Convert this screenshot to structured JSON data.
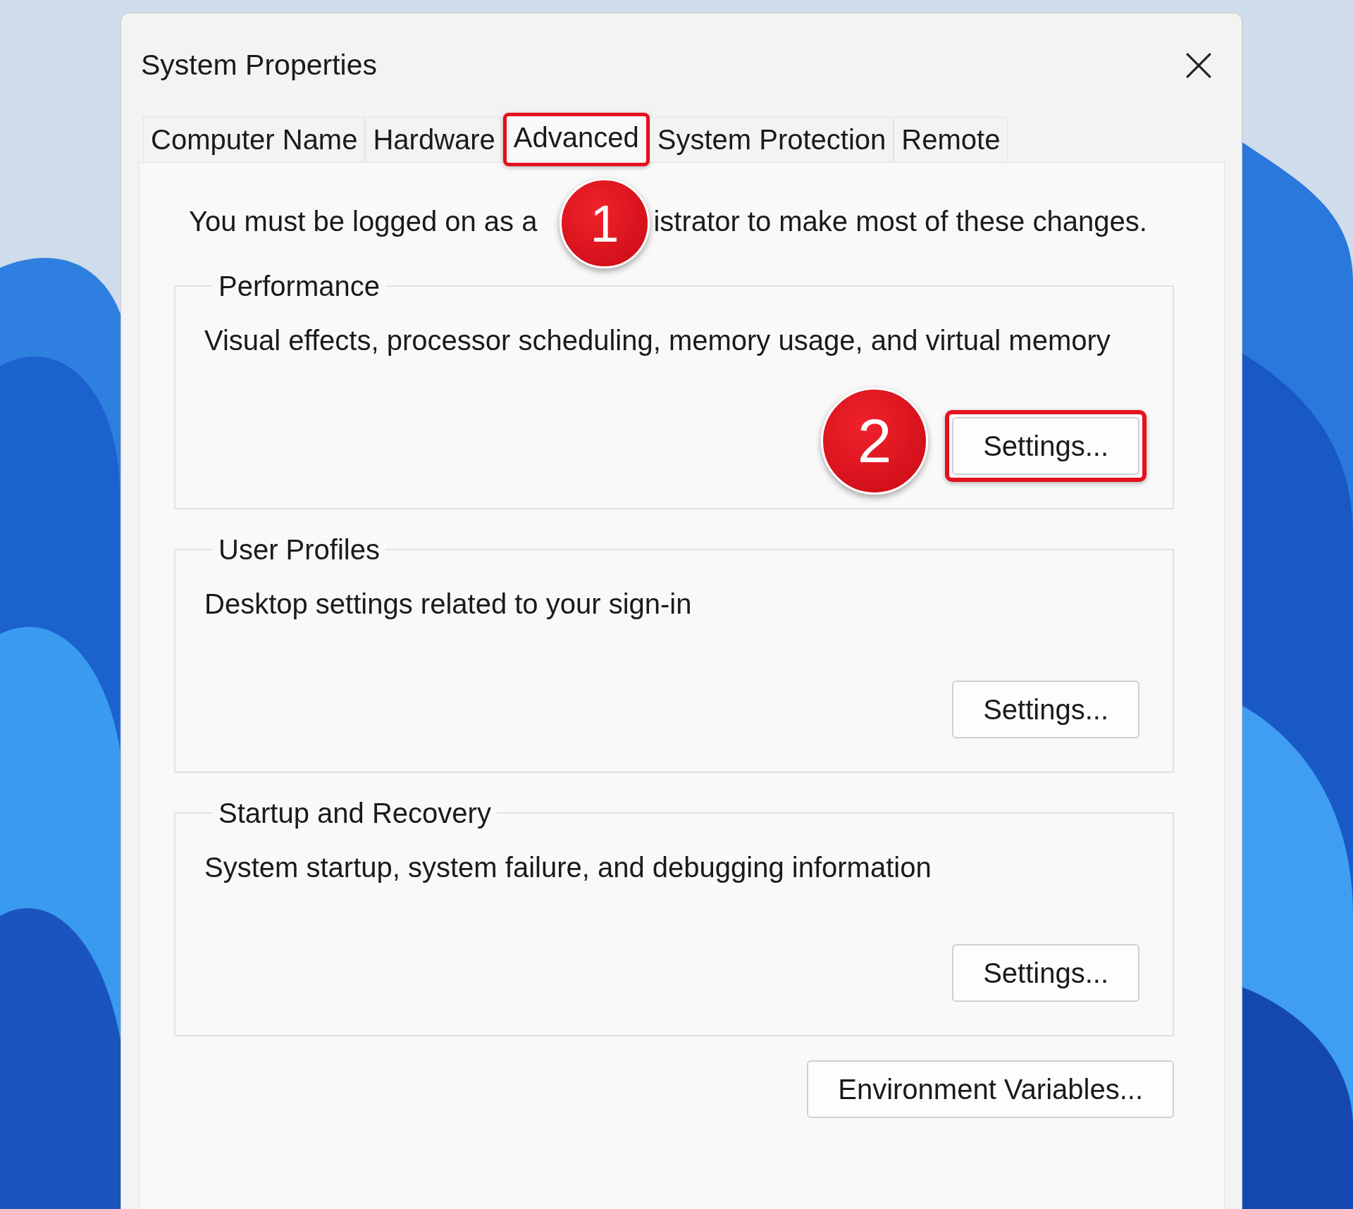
{
  "window": {
    "title": "System Properties"
  },
  "tabs": [
    {
      "label": "Computer Name",
      "selected": false,
      "highlighted": false
    },
    {
      "label": "Hardware",
      "selected": false,
      "highlighted": false
    },
    {
      "label": "Advanced",
      "selected": true,
      "highlighted": true
    },
    {
      "label": "System Protection",
      "selected": false,
      "highlighted": false
    },
    {
      "label": "Remote",
      "selected": false,
      "highlighted": false
    }
  ],
  "notice": {
    "before": "You must be logged on as a",
    "after": "istrator to make most of these changes."
  },
  "groups": [
    {
      "title": "Performance",
      "description": "Visual effects, processor scheduling, memory usage, and virtual memory",
      "button": "Settings...",
      "highlighted": true
    },
    {
      "title": "User Profiles",
      "description": "Desktop settings related to your sign-in",
      "button": "Settings...",
      "highlighted": false
    },
    {
      "title": "Startup and Recovery",
      "description": "System startup, system failure, and debugging information",
      "button": "Settings...",
      "highlighted": false
    }
  ],
  "environment_button": "Environment Variables...",
  "callouts": [
    {
      "label": "1"
    },
    {
      "label": "2"
    }
  ]
}
